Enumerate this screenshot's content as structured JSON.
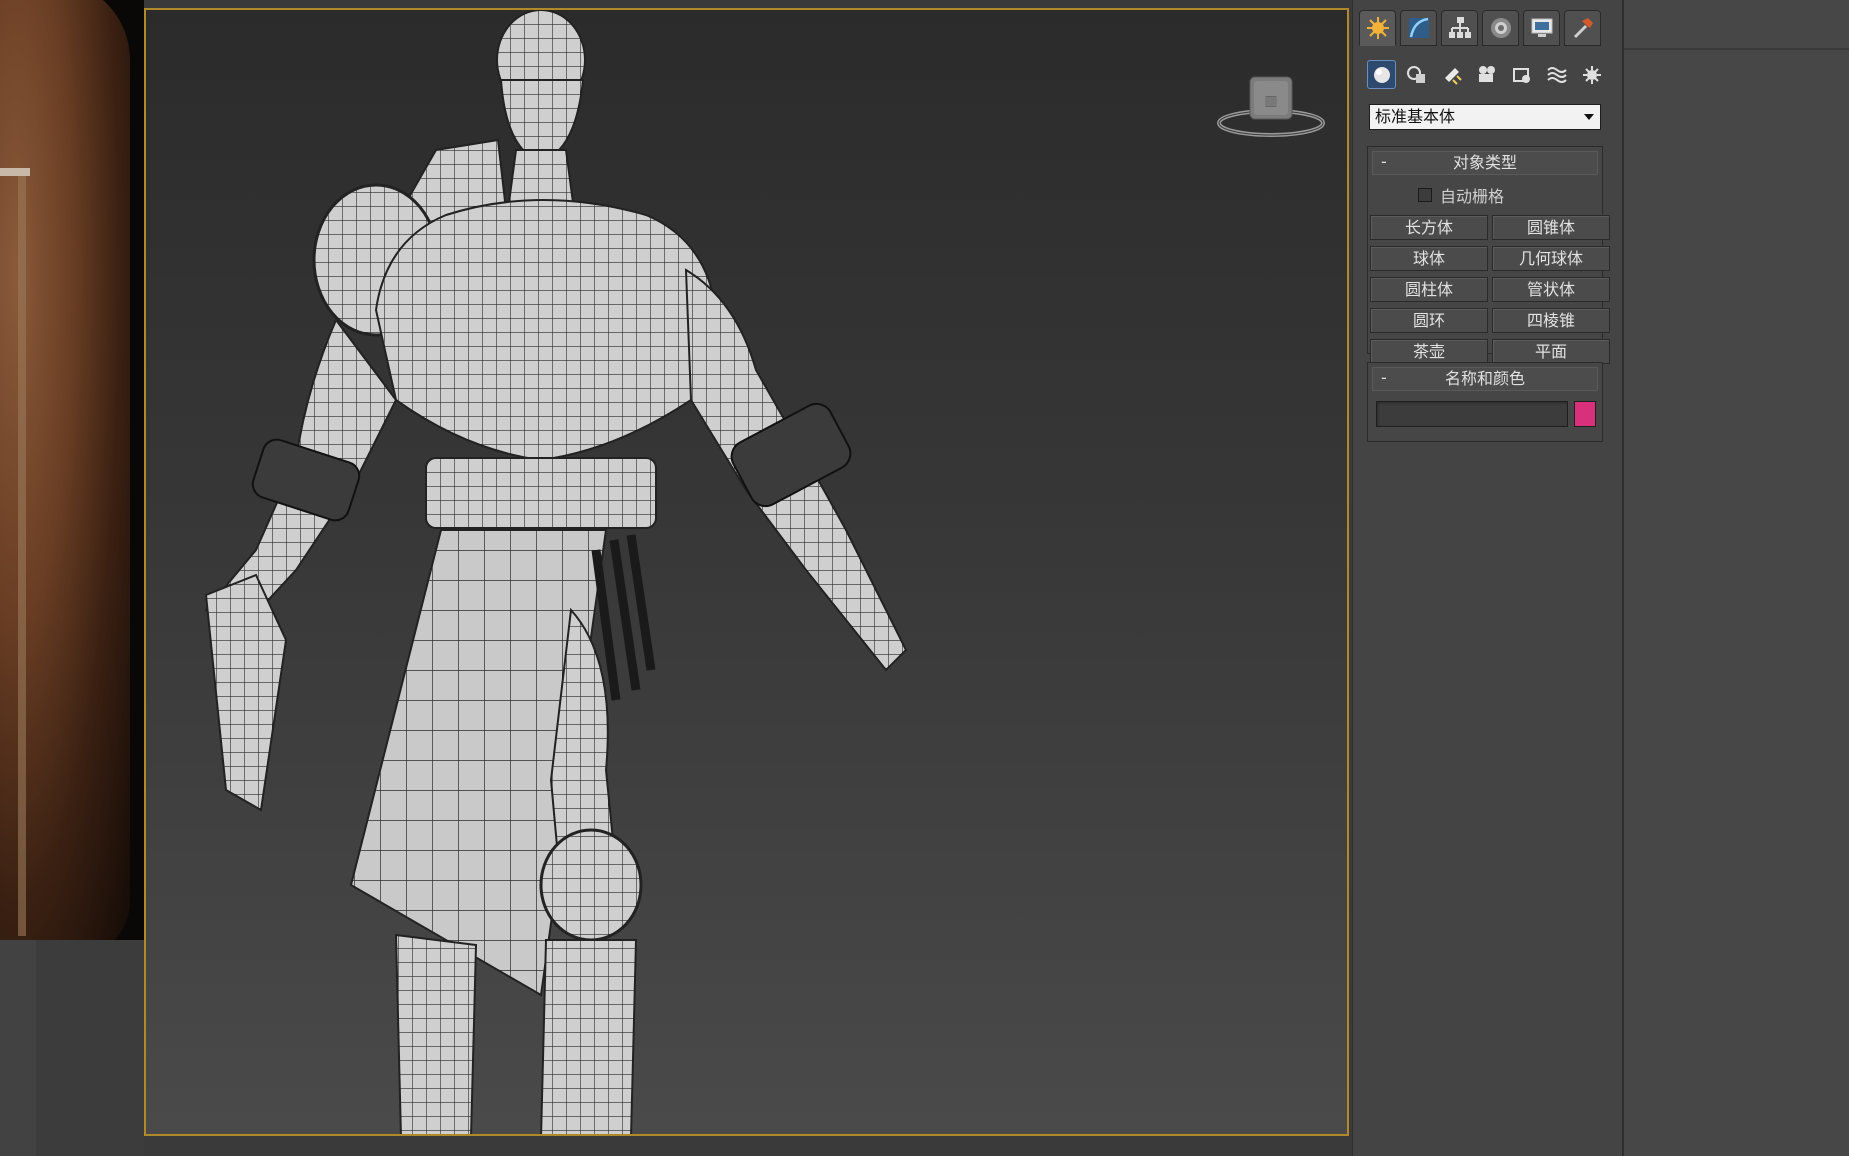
{
  "command_panel": {
    "tabs": [
      {
        "icon": "create-icon",
        "active": true
      },
      {
        "icon": "modify-icon",
        "active": false
      },
      {
        "icon": "hierarchy-icon",
        "active": false
      },
      {
        "icon": "motion-icon",
        "active": false
      },
      {
        "icon": "display-icon",
        "active": false
      },
      {
        "icon": "utilities-icon",
        "active": false
      }
    ],
    "sub_icons": [
      {
        "icon": "geometry-icon",
        "active": true
      },
      {
        "icon": "shapes-icon",
        "active": false
      },
      {
        "icon": "lights-icon",
        "active": false
      },
      {
        "icon": "cameras-icon",
        "active": false
      },
      {
        "icon": "helpers-icon",
        "active": false
      },
      {
        "icon": "space-warps-icon",
        "active": false
      },
      {
        "icon": "systems-icon",
        "active": false
      }
    ],
    "category_dropdown": {
      "selected": "标准基本体"
    },
    "object_type": {
      "title": "对象类型",
      "collapse_symbol": "-",
      "autogrid_label": "自动栅格",
      "autogrid_checked": false,
      "buttons": [
        "长方体",
        "圆锥体",
        "球体",
        "几何球体",
        "圆柱体",
        "管状体",
        "圆环",
        "四棱锥",
        "茶壶",
        "平面"
      ]
    },
    "name_and_color": {
      "title": "名称和颜色",
      "collapse_symbol": "-",
      "name_value": "",
      "color": "#d8307a"
    }
  },
  "viewport": {
    "border_color": "#b08a2a",
    "view_cube_icon": "viewcube-icon"
  }
}
